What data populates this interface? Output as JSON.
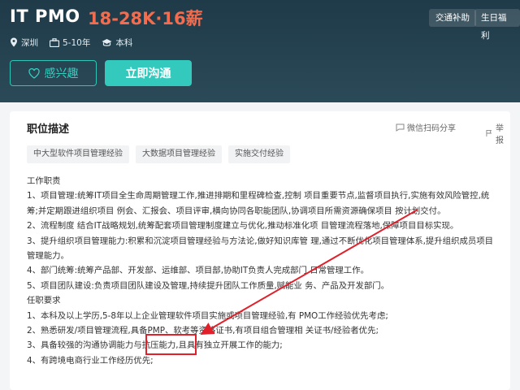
{
  "header": {
    "title": "IT PMO",
    "salary": "18-28K·16薪",
    "tags": [
      "交通补助",
      "生日福利"
    ],
    "meta": [
      {
        "icon": "location-icon",
        "text": "深圳"
      },
      {
        "icon": "briefcase-icon",
        "text": "5-10年"
      },
      {
        "icon": "graduation-cap-icon",
        "text": "本科"
      }
    ],
    "interest_label": "感兴趣",
    "chat_label": "立即沟通"
  },
  "card": {
    "section_title": "职位描述",
    "share_label": "微信扫码分享",
    "report_label": "举报",
    "skills": [
      "中大型软件项目管理经验",
      "大数据项目管理经验",
      "实施交付经验"
    ],
    "lines": [
      "工作职责",
      "1、项目管理:统筹IT项目全生命周期管理工作,推进排期和里程碑检查,控制 项目重要节点,监督项目执行,实施有效风险管控,统",
      "筹;并定期跟进组织项目 例会、汇报会、项目评审,横向协同各职能团队,协调项目所需资源确保项目 按计划交付。",
      "2、流程制度 结合IT战略规划,统筹配套项目管理制度建立与优化,推动标准化项 目管理流程落地,保障项目目标实现。",
      "3、提升组织项目管理能力:积累和沉淀项目管理经验与方法论,做好知识库管 理,通过不断优化项目管理体系,提升组织成员项目",
      "管理能力。",
      "4、部门统筹:统筹产品部、开发部、运维部、项目部,协助IT负责人完成部门 日常管理工作。",
      "5、项目团队建设:负责项目团队建设及管理,持续提升团队工作质量,赋能业 务、产品及开发部门。",
      "任职要求",
      "1、本科及以上学历,5-8年以上企业管理软件项目实施或项目管理经验,有 PMO工作经验优先考虑;",
      "2、熟悉研发/项目管理流程,具备PMP、软考等资格证书,有项目组合管理相 关证书/经验者优先;",
      "3、具备较强的沟通协调能力与抗压能力,且具有独立开展工作的能力;",
      "4、有跨境电商行业工作经历优先;"
    ]
  },
  "colors": {
    "header_bg": "#213d4a",
    "salary": "#f26d4f",
    "accent": "#34c9bd",
    "annotation": "#e0202a"
  }
}
